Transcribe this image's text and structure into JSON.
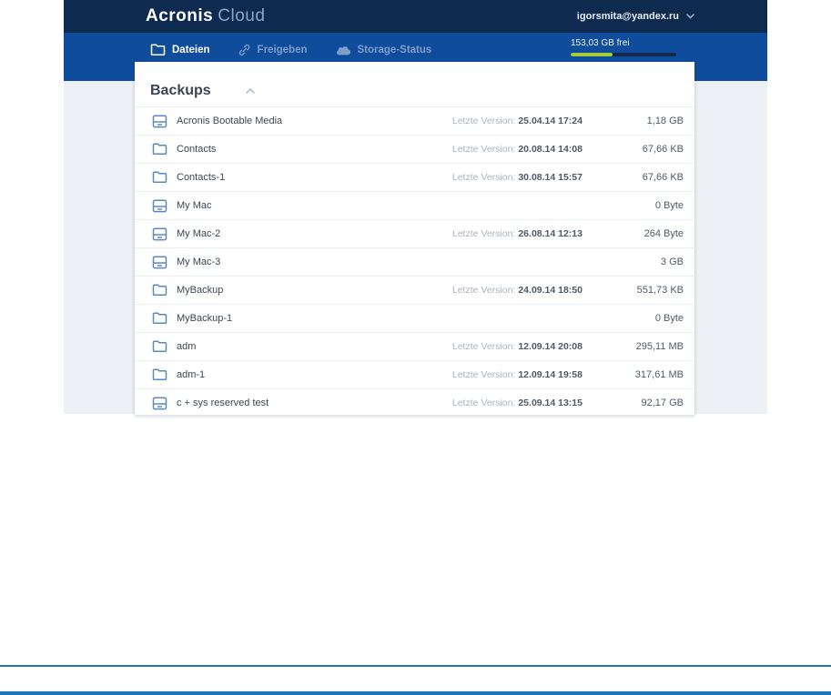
{
  "header": {
    "logo_primary": "Acronis",
    "logo_secondary": "Cloud",
    "user_email": "igorsmita@yandex.ru"
  },
  "nav": {
    "tabs": [
      {
        "label": "Dateien",
        "icon": "folder-icon",
        "active": true
      },
      {
        "label": "Freigeben",
        "icon": "link-icon",
        "active": false
      },
      {
        "label": "Storage-Status",
        "icon": "cloud-icon",
        "active": false
      }
    ],
    "storage": {
      "label": "153,03 GB frei",
      "used_percent": 40
    }
  },
  "content": {
    "title": "Backups",
    "collapse_icon": "chevron-up-icon",
    "version_label": "Letzte Version:",
    "rows": [
      {
        "name": "Acronis Bootable Media",
        "icon": "disk-icon",
        "version": "25.04.14 17:24",
        "size": "1,18 GB"
      },
      {
        "name": "Contacts",
        "icon": "folder-icon",
        "version": "20.08.14 14:08",
        "size": "67,66 KB"
      },
      {
        "name": "Contacts-1",
        "icon": "folder-icon",
        "version": "30.08.14 15:57",
        "size": "67,66 KB"
      },
      {
        "name": "My Mac",
        "icon": "disk-icon",
        "version": "",
        "size": "0 Byte"
      },
      {
        "name": "My Mac-2",
        "icon": "disk-icon",
        "version": "26.08.14 12:13",
        "size": "264 Byte"
      },
      {
        "name": "My Mac-3",
        "icon": "disk-icon",
        "version": "",
        "size": "3 GB"
      },
      {
        "name": "MyBackup",
        "icon": "folder-icon",
        "version": "24.09.14 18:50",
        "size": "551,73 KB"
      },
      {
        "name": "MyBackup-1",
        "icon": "folder-icon",
        "version": "",
        "size": "0 Byte"
      },
      {
        "name": "adm",
        "icon": "folder-icon",
        "version": "12.09.14 20:08",
        "size": "295,11 MB"
      },
      {
        "name": "adm-1",
        "icon": "folder-icon",
        "version": "12.09.14 19:58",
        "size": "317,61 MB"
      },
      {
        "name": "c + sys reserved test",
        "icon": "disk-icon",
        "version": "25.09.14 13:15",
        "size": "92,17 GB"
      }
    ]
  },
  "colors": {
    "header_bg": "#0e2b4f",
    "nav_bg": "#0f4c9c",
    "accent_green": "#a8cc39",
    "footer_line_blue": "#1d76bc",
    "gutter_gray": "#edf0f4",
    "row_icon_blue": "#5a88c6"
  }
}
